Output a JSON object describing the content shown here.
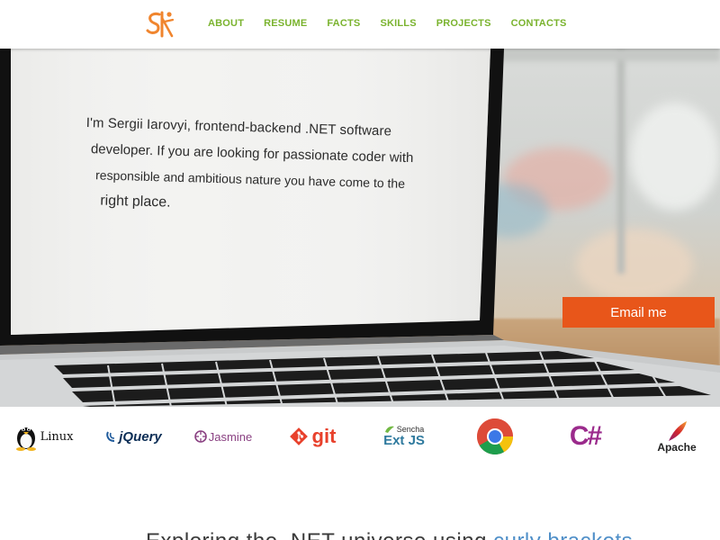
{
  "header": {
    "logo_text": "SI",
    "nav": [
      {
        "label": "ABOUT"
      },
      {
        "label": "RESUME"
      },
      {
        "label": "FACTS"
      },
      {
        "label": "SKILLS"
      },
      {
        "label": "PROJECTS"
      },
      {
        "label": "CONTACTS"
      }
    ]
  },
  "hero": {
    "intro_lines": [
      "I'm Sergii Iarovyi, frontend-backend .NET software",
      "developer. If you are looking for passionate coder with",
      "responsible and ambitious nature you have come to the",
      "right place."
    ],
    "email_button": "Email me"
  },
  "technologies": [
    {
      "name": "Linux",
      "icon": "linux-tux-icon"
    },
    {
      "name": "jQuery",
      "icon": "jquery-icon"
    },
    {
      "name": "Jasmine",
      "icon": "jasmine-icon"
    },
    {
      "name": "git",
      "icon": "git-icon"
    },
    {
      "name": "Ext JS",
      "caption": "Sencha",
      "icon": "sencha-extjs-icon"
    },
    {
      "name": "Chrome",
      "icon": "chrome-icon"
    },
    {
      "name": "C#",
      "icon": "csharp-icon"
    },
    {
      "name": "Apache",
      "icon": "apache-feather-icon"
    }
  ],
  "tagline": {
    "text_before": "Exploring the .NET universe using ",
    "text_highlight": "curly brackets"
  },
  "colors": {
    "accent": "#e8561a",
    "nav": "#7ab32e",
    "logo": "#f0852e",
    "tagline_highlight": "#4f8fc8",
    "git": "#e8412c",
    "jasmine": "#8a4182",
    "csharp": "#9b2b8c"
  }
}
